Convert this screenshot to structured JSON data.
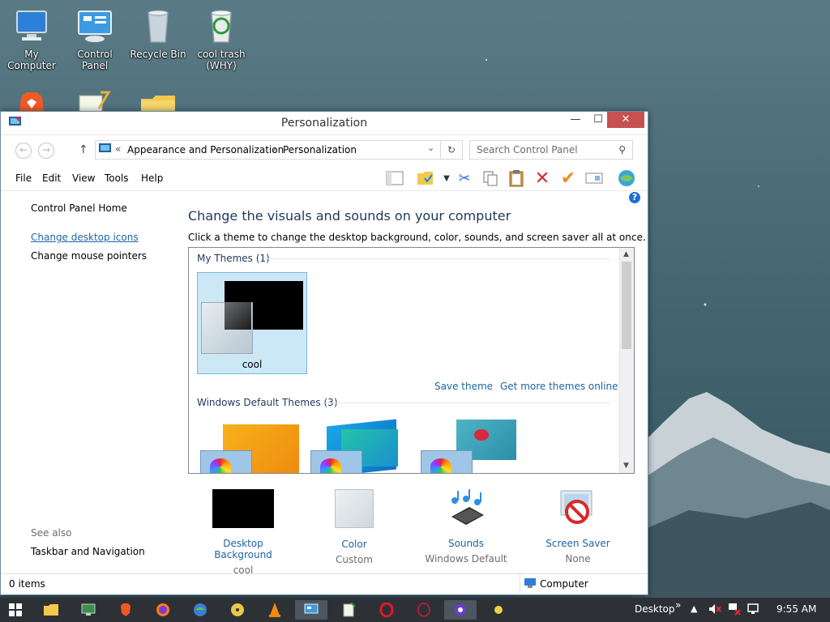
{
  "desktop": {
    "icons": [
      {
        "label": "My Computer"
      },
      {
        "label": "Control Panel"
      },
      {
        "label": "Recycle Bin"
      },
      {
        "label": "cool trash (WHY)"
      }
    ]
  },
  "window": {
    "title": "Personalization",
    "controls": {
      "minimize": "—",
      "maximize": "☐",
      "close": "✕"
    },
    "address": {
      "breadcrumb_sep_start": "«",
      "crumb1": "Appearance and Personalization",
      "crumb_sep": "›",
      "crumb2": "Personalization"
    },
    "search": {
      "placeholder": "Search Control Panel"
    },
    "menu": [
      "File",
      "Edit",
      "View",
      "Tools",
      "Help"
    ],
    "sidebar": {
      "home": "Control Panel Home",
      "links": [
        "Change desktop icons",
        "Change mouse pointers"
      ],
      "see_also_title": "See also",
      "see_also_links": [
        "Taskbar and Navigation"
      ]
    },
    "main": {
      "heading": "Change the visuals and sounds on your computer",
      "description": "Click a theme to change the desktop background, color, sounds, and screen saver all at once.",
      "my_themes_header": "My Themes (1)",
      "my_theme_name": "cool",
      "save_theme": "Save theme",
      "get_more_themes": "Get more themes online",
      "default_themes_header": "Windows Default Themes (3)"
    },
    "bottom": [
      {
        "label": "Desktop Background",
        "sub": "cool"
      },
      {
        "label": "Color",
        "sub": "Custom"
      },
      {
        "label": "Sounds",
        "sub": "Windows Default"
      },
      {
        "label": "Screen Saver",
        "sub": "None"
      }
    ],
    "status": {
      "items": "0 items",
      "location": "Computer"
    }
  },
  "taskbar": {
    "desktop_label": "Desktop",
    "chevron": "»",
    "time": "9:55 AM"
  },
  "colors": {
    "accent": "#1c64a6",
    "heading": "#1e395b",
    "close": "#c75050",
    "selection": "#cce8f7"
  }
}
